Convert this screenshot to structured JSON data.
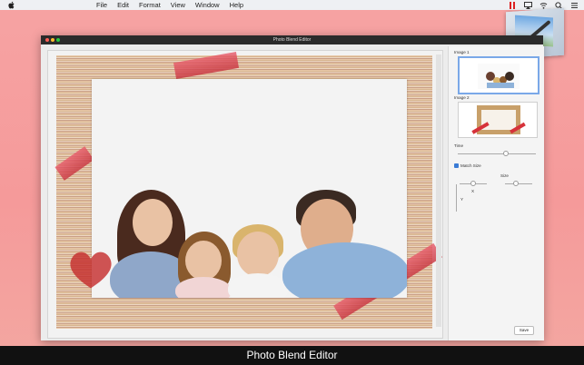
{
  "menubar": {
    "items": [
      "File",
      "Edit",
      "Format",
      "View",
      "Window",
      "Help"
    ]
  },
  "window": {
    "title": "Photo Blend Editor"
  },
  "panel": {
    "image1_label": "Image 1",
    "image2_label": "Image 2",
    "time_label": "Time",
    "match_size_label": "Match Size",
    "size_label": "Size",
    "x_label": "X",
    "y_label": "Y",
    "save_label": "Save",
    "match_size_checked": true,
    "time_level": 0.6
  },
  "caption": {
    "text": "Photo Blend Editor"
  },
  "icons": {
    "apple": "apple-icon",
    "status": [
      "record-icon",
      "airplay-icon",
      "wifi-icon",
      "search-icon",
      "list-icon"
    ]
  },
  "colors": {
    "accent": "#7aa8e8",
    "background": "#f6a3a3",
    "titlebar": "#2b2b2b",
    "caption_bar": "#111111"
  }
}
